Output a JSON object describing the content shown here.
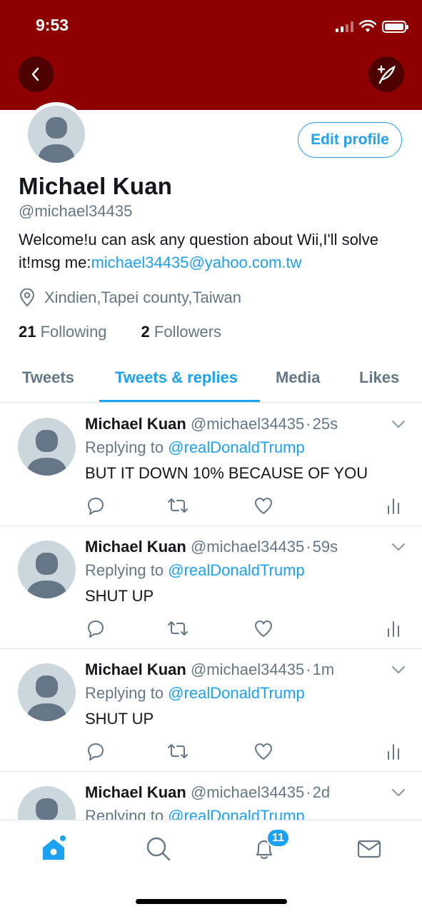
{
  "status_bar": {
    "time": "9:53"
  },
  "header": {
    "back_icon": "chevron-left-icon",
    "compose_icon": "compose-feather-icon",
    "banner_color": "#8e0000"
  },
  "profile": {
    "name": "Michael Kuan",
    "handle": "@michael34435",
    "bio_text": "Welcome!u can ask any question about Wii,I'll solve it!msg me:",
    "bio_link": "michael34435@yahoo.com.tw",
    "location": "Xindien,Tapei county,Taiwan",
    "following_count": "21",
    "following_label": "Following",
    "followers_count": "2",
    "followers_label": "Followers",
    "edit_button": "Edit profile"
  },
  "tabs": [
    {
      "label": "Tweets",
      "active": false
    },
    {
      "label": "Tweets & replies",
      "active": true
    },
    {
      "label": "Media",
      "active": false
    },
    {
      "label": "Likes",
      "active": false
    }
  ],
  "tweets": [
    {
      "name": "Michael Kuan",
      "handle": "@michael34435",
      "sep": "·",
      "time": "25s",
      "replying_prefix": "Replying to",
      "replying_to": "@realDonaldTrump",
      "text": "BUT IT DOWN 10% BECAUSE OF YOU"
    },
    {
      "name": "Michael Kuan",
      "handle": "@michael34435",
      "sep": "·",
      "time": "59s",
      "replying_prefix": "Replying to",
      "replying_to": "@realDonaldTrump",
      "text": "SHUT UP"
    },
    {
      "name": "Michael Kuan",
      "handle": "@michael34435",
      "sep": "·",
      "time": "1m",
      "replying_prefix": "Replying to",
      "replying_to": "@realDonaldTrump",
      "text": "SHUT UP"
    },
    {
      "name": "Michael Kuan",
      "handle": "@michael34435",
      "sep": "·",
      "time": "2d",
      "replying_prefix": "Replying to",
      "replying_to": "@realDonaldTrump",
      "text": ""
    }
  ],
  "bottom_nav": {
    "items": [
      "home-icon",
      "search-icon",
      "notifications-bell-icon",
      "messages-envelope-icon"
    ],
    "notification_badge": "11"
  },
  "colors": {
    "accent": "#1da1f2",
    "secondary_text": "#657786",
    "avatar_gray": "#ccd6dd"
  }
}
